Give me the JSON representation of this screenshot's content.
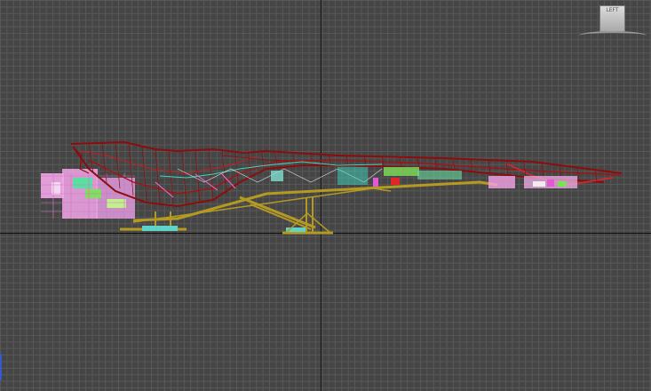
{
  "viewport": {
    "view_label": "LEFT",
    "grid_color": "#585858",
    "background_color": "#454545",
    "axis_color": "#111111"
  },
  "viewcube": {
    "face_label": "LEFT"
  },
  "model": {
    "wire_color": "#8b0d0d",
    "highlight_color": "#e0262a",
    "frame_color": "#b59a22",
    "accent_colors": [
      "#f5a3e6",
      "#3fd6c0",
      "#7ee05a",
      "#e05ad8"
    ]
  }
}
